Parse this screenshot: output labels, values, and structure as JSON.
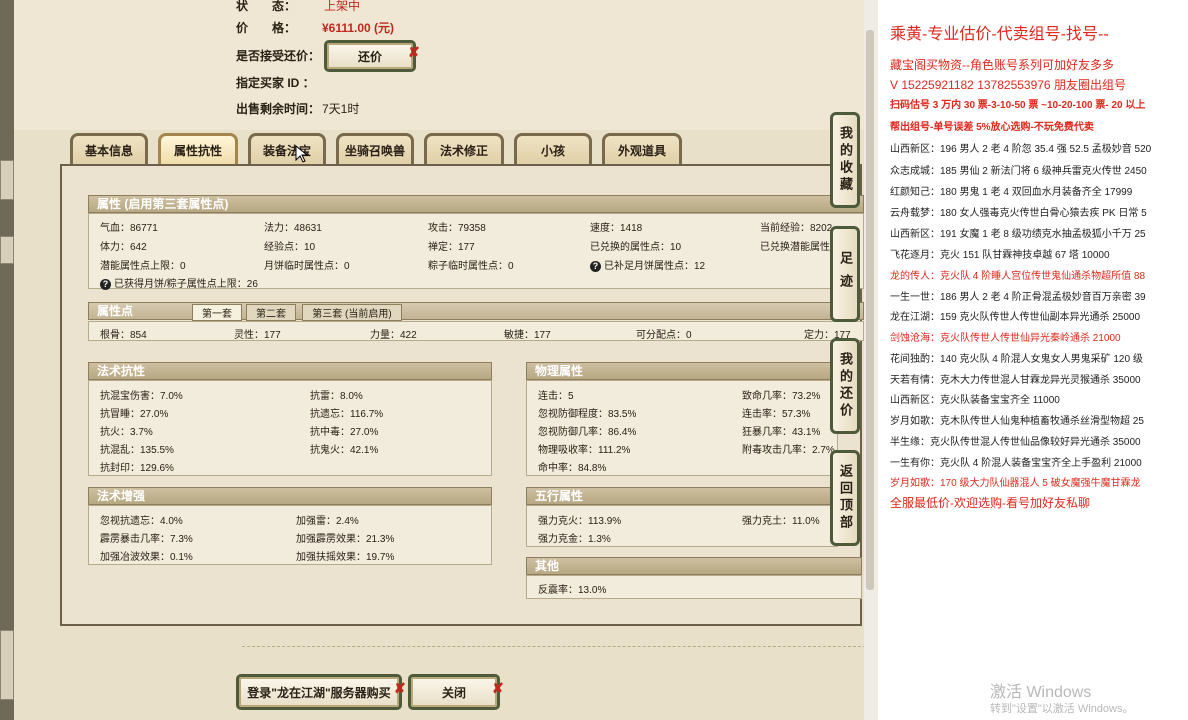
{
  "listing": {
    "status_label": "状　　态：",
    "status_value": "上架中",
    "price_label": "价　　格：",
    "price_value": "¥6111.00 (元)",
    "counter_offer_label": "是否接受还价：",
    "counter_offer_button": "还价",
    "buyer_id_label": "指定买家 ID ：",
    "remaining_label": "出售剩余时间：",
    "remaining_value": "7天1时"
  },
  "tabs": [
    "基本信息",
    "属性抗性",
    "装备法宝",
    "坐骑召唤兽",
    "法术修正",
    "小孩",
    "外观道具"
  ],
  "active_tab": "属性抗性",
  "attributes": {
    "header": "属性 (启用第三套属性点)",
    "rows": [
      [
        "气血：86771",
        "法力：48631",
        "攻击：79358",
        "速度：1418",
        "当前经验：8202"
      ],
      [
        "体力：642",
        "经验点：10",
        "禅定：177",
        "已兑换的属性点：10",
        "已兑换潜能属性"
      ],
      [
        "潜能属性点上限：0",
        "月饼临时属性点：0",
        "粽子临时属性点：0",
        "已补足月饼属性点：12"
      ]
    ],
    "note": "已获得月饼/粽子属性点上限：26"
  },
  "attribute_points": {
    "header": "属性点",
    "subtabs": [
      "第一套",
      "第二套",
      "第三套 (当前启用)"
    ],
    "active_subtab": "第一套",
    "values": [
      "根骨：854",
      "灵性：177",
      "力量：422",
      "敏捷：177",
      "可分配点：0",
      "定力：177"
    ]
  },
  "spell_resistance": {
    "header": "法术抗性",
    "rows": [
      [
        "抗混宝伤害：7.0%",
        "抗雷：8.0%"
      ],
      [
        "抗冒睡：27.0%",
        "抗遗忘：116.7%"
      ],
      [
        "抗火：3.7%",
        "抗中毒：27.0%"
      ],
      [
        "抗混乱：135.5%",
        "抗鬼火：42.1%"
      ],
      [
        "抗封印：129.6%"
      ]
    ]
  },
  "spell_boost": {
    "header": "法术增强",
    "rows": [
      [
        "忽视抗遗忘：4.0%",
        "加强雷：2.4%"
      ],
      [
        "霹雳暴击几率：7.3%",
        "加强霹雳效果：21.3%"
      ],
      [
        "加强冶波效果：0.1%",
        "加强扶摇效果：19.7%"
      ]
    ]
  },
  "physical": {
    "header": "物理属性",
    "rows": [
      [
        "连击：5",
        "致命几率：73.2%"
      ],
      [
        "忽视防御程度：83.5%",
        "连击率：57.3%"
      ],
      [
        "忽视防御几率：86.4%",
        "狂暴几率：43.1%"
      ],
      [
        "物理吸收率：111.2%",
        "附毒攻击几率：2.7%"
      ],
      [
        "命中率：84.8%"
      ]
    ]
  },
  "five_elements": {
    "header": "五行属性",
    "rows": [
      [
        "强力克火：113.9%",
        "强力克土：11.0%"
      ],
      [
        "强力克金：1.3%"
      ]
    ]
  },
  "other": {
    "header": "其他",
    "rows": [
      [
        "反震率：13.0%"
      ]
    ]
  },
  "side_buttons": [
    "我的收藏",
    "足迹",
    "我的还价",
    "返回顶部"
  ],
  "bottom_buttons": {
    "login": "登录\"龙在江湖\"服务器购买",
    "close": "关闭"
  },
  "document": {
    "lines": [
      {
        "text": "乘黄-专业估价-代卖组号-找号--",
        "style": "title"
      },
      {
        "text": "藏宝阁买物资--角色账号系列可加好友多多",
        "style": "red"
      },
      {
        "text": "V 15225921182    13782553976  朋友圈出组号",
        "style": "red"
      },
      {
        "text": "扫码估号 3 万内 30 票-3-10-50 票  ~10-20-100 票- 20 以上",
        "style": "redbold"
      },
      {
        "text": "帮出组号-单号误差 5%放心选购-不玩免费代卖",
        "style": "redbold"
      },
      {
        "text": "山西新区：196 男人 2 老 4 阶忽 35.4 强 52.5 孟极妙音 520",
        "style": "normal"
      },
      {
        "text": "众志成城：185 男仙 2 新法门将 6 级神兵雷克火传世 2450",
        "style": "normal"
      },
      {
        "text": "红颜知己：180 男鬼 1 老 4 双回血水月装备齐全 17999",
        "style": "normal"
      },
      {
        "text": "云舟载梦：180 女人强毒克火传世白骨心猿去疾 PK 日常 5",
        "style": "normal"
      },
      {
        "text": "山西新区：191 女魔 1 老 8 级功绩克水抽孟极狐小千万 25",
        "style": "normal"
      },
      {
        "text": "飞花逐月：克火 151 队甘霖神技卓越 67 塔 10000",
        "style": "normal"
      },
      {
        "text": "龙的传人：克火队 4 阶睡人宫位传世鬼仙通杀物超所值 88",
        "style": "red"
      },
      {
        "text": "一生一世：186 男人 2 老 4 阶正骨混孟极妙音百万亲密 39",
        "style": "normal"
      },
      {
        "text": "龙在江湖：159 克火队传世人传世仙副本异光通杀 25000",
        "style": "normal"
      },
      {
        "text": "剑蚀沧海：克火队传世人传世仙异光秦岭通杀 21000",
        "style": "red"
      },
      {
        "text": "花间独酌：140 克火队 4 阶混人女鬼女人男鬼采矿 120 级",
        "style": "normal"
      },
      {
        "text": "天若有情：克木大力传世混人甘霖龙异光灵猴通杀 35000",
        "style": "normal"
      },
      {
        "text": "山西新区：克火队装备宝宝齐全 11000",
        "style": "normal"
      },
      {
        "text": "岁月如歌：克木队传世人仙鬼种植畜牧通杀丝滑型物超 25",
        "style": "normal"
      },
      {
        "text": "半生缘：克火队传世混人传世仙品像较好异光通杀 35000",
        "style": "normal"
      },
      {
        "text": "一生有你：克火队 4 阶混人装备宝宝齐全上手盈利 21000",
        "style": "normal"
      },
      {
        "text": "岁月如歌：170 级大力队仙器混人 5 破女魔强牛魔甘霖龙",
        "style": "red"
      },
      {
        "text": "全服最低价-欢迎选购-看号加好友私聊",
        "style": "red"
      }
    ],
    "watermark_title": "激活 Windows",
    "watermark_sub": "转到\"设置\"以激活 Windows。"
  }
}
